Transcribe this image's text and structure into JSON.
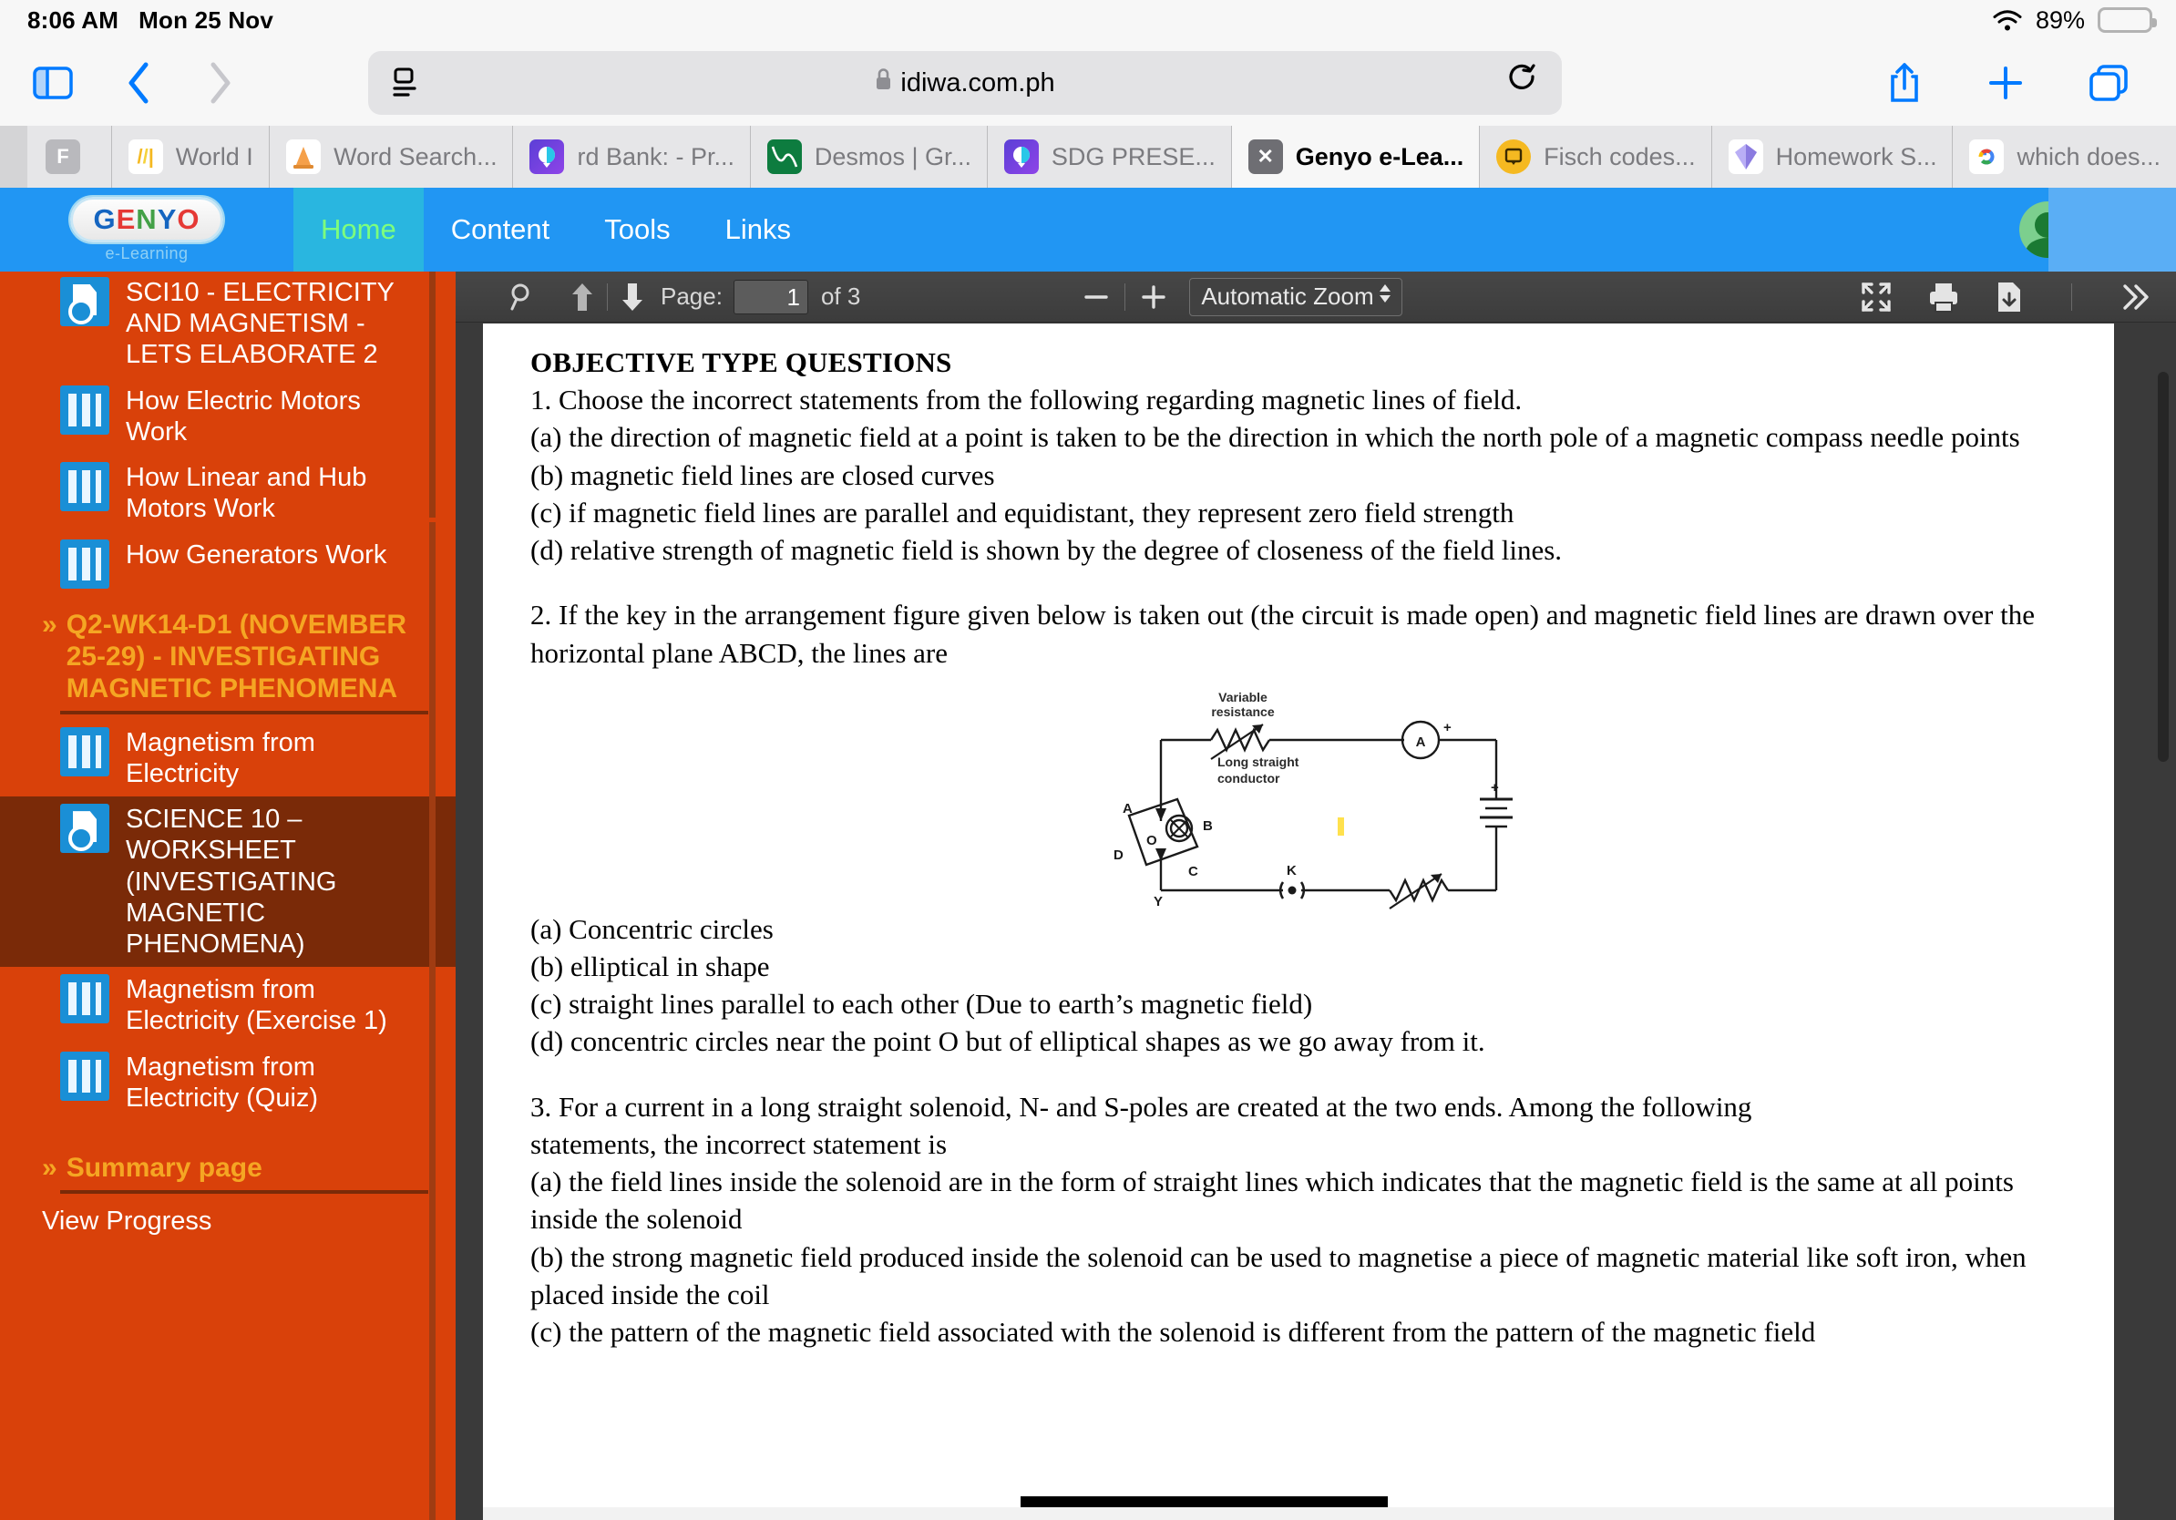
{
  "status_bar": {
    "time": "8:06 AM",
    "date": "Mon 25 Nov",
    "battery_percent": "89%",
    "wifi_icon": "wifi-icon",
    "battery_icon": "battery-icon",
    "battery_color": "#ffcc00"
  },
  "browser": {
    "sidebar_toggle_icon": "sidebar-toggle-icon",
    "back_icon": "chevron-left-icon",
    "forward_icon": "chevron-right-icon",
    "reader_icon": "reader-view-icon",
    "lock_icon": "lock-icon",
    "url": "idiwa.com.ph",
    "reload_icon": "reload-icon",
    "share_icon": "share-icon",
    "new_tab_icon": "plus-icon",
    "tabs_overview_icon": "tabs-overview-icon"
  },
  "tabs": [
    {
      "label": "",
      "favicon": "F",
      "favicon_color": "#b9b9bd",
      "active": false,
      "pinned": true
    },
    {
      "label": "World I",
      "favicon": "//|",
      "favicon_color": "#ffffff",
      "active": false,
      "pinned": false
    },
    {
      "label": "Word Search...",
      "favicon": "traffic-cone-icon",
      "favicon_color": "#ffffff",
      "active": false,
      "pinned": false
    },
    {
      "label": "rd Bank: - Pr...",
      "favicon": "quizizz-icon",
      "favicon_color": "#8854d0",
      "active": false,
      "pinned": false
    },
    {
      "label": "Desmos | Gr...",
      "favicon": "desmos-icon",
      "favicon_color": "#0d7c3f",
      "active": false,
      "pinned": false
    },
    {
      "label": "SDG PRESE...",
      "favicon": "quizizz-icon",
      "favicon_color": "#8854d0",
      "active": false,
      "pinned": false
    },
    {
      "label": "Genyo e-Lea...",
      "favicon": "x-icon",
      "favicon_color": "#6e6e73",
      "active": true,
      "pinned": false
    },
    {
      "label": "Fisch codes...",
      "favicon": "figma-jam-icon",
      "favicon_color": "#f5b921",
      "active": false,
      "pinned": false
    },
    {
      "label": "Homework S...",
      "favicon": "gem-icon",
      "favicon_color": "#ffffff",
      "active": false,
      "pinned": false
    },
    {
      "label": "which does...",
      "favicon": "google-icon",
      "favicon_color": "#ffffff",
      "active": false,
      "pinned": false
    }
  ],
  "genyo_nav": {
    "logo_text": "GENYO",
    "logo_sub": "e-Learning",
    "items": [
      {
        "label": "Home",
        "active": true
      },
      {
        "label": "Content",
        "active": false
      },
      {
        "label": "Tools",
        "active": false
      },
      {
        "label": "Links",
        "active": false
      }
    ],
    "avatar": "user-avatar",
    "chevron": "chevron-down-icon"
  },
  "sidebar": {
    "background": "#d9410a",
    "items": [
      {
        "type": "item",
        "icon": "doc",
        "label": "SCI10 - ELECTRICITY AND MAGNETISM - LETS ELABORATE 2",
        "selected": false
      },
      {
        "type": "item",
        "icon": "bars",
        "label": "How Electric Motors Work",
        "selected": false
      },
      {
        "type": "item",
        "icon": "bars",
        "label": "How Linear and Hub Motors Work",
        "selected": false
      },
      {
        "type": "item",
        "icon": "bars",
        "label": "How Generators Work",
        "selected": false
      },
      {
        "type": "section",
        "label": "Q2-WK14-D1 (NOVEMBER 25-29) - INVESTIGATING MAGNETIC PHENOMENA",
        "chevron": "»"
      },
      {
        "type": "item",
        "icon": "bars",
        "label": "Magnetism from Electricity",
        "selected": false
      },
      {
        "type": "item",
        "icon": "doc",
        "label": "SCIENCE 10 – WORKSHEET (INVESTIGATING MAGNETIC PHENOMENA)",
        "selected": true
      },
      {
        "type": "item",
        "icon": "bars",
        "label": "Magnetism from Electricity (Exercise 1)",
        "selected": false
      },
      {
        "type": "item",
        "icon": "bars",
        "label": "Magnetism from Electricity (Quiz)",
        "selected": false
      },
      {
        "type": "section",
        "label": "Summary page",
        "chevron": "»"
      },
      {
        "type": "plain",
        "label": "View Progress"
      }
    ]
  },
  "pdf_toolbar": {
    "search_icon": "search-icon",
    "prev_page_icon": "arrow-up-icon",
    "next_page_icon": "arrow-down-icon",
    "page_label": "Page:",
    "page_value": "1",
    "page_total": "of 3",
    "zoom_out_icon": "minus-icon",
    "zoom_in_icon": "plus-icon",
    "zoom_value": "Automatic Zoom",
    "presentation_icon": "fullscreen-icon",
    "print_icon": "print-icon",
    "download_icon": "download-icon",
    "more_icon": "double-chevron-right-icon"
  },
  "document": {
    "heading": "OBJECTIVE TYPE QUESTIONS",
    "q1": {
      "stem": "1. Choose the incorrect statements from the following regarding magnetic lines of field.",
      "options": [
        "(a) the direction of magnetic field at a point is taken to be the direction in which the north pole of a magnetic compass needle points",
        "(b) magnetic field lines are closed curves",
        "(c) if magnetic field lines are parallel and equidistant, they represent zero field strength",
        "(d) relative strength of magnetic field is shown by the degree of closeness of the field lines."
      ]
    },
    "q2": {
      "stem": "2. If the key in the arrangement figure given below is taken out (the circuit is made open) and magnetic field lines are drawn over the horizontal plane ABCD, the lines are",
      "figure": {
        "labels": [
          "Variable resistance",
          "Long straight conductor",
          "A",
          "B",
          "C",
          "D",
          "O",
          "K",
          "Y",
          "A",
          "+",
          "+"
        ],
        "variable_resistance": "Variable\nresistance",
        "conductor": "Long straight\nconductor",
        "ammeter": "A",
        "plane_points": [
          "A",
          "B",
          "C",
          "D"
        ],
        "center": "O",
        "key": "K",
        "terminal": "Y"
      },
      "options": [
        "(a) Concentric circles",
        "(b) elliptical in shape",
        "(c) straight lines parallel to each other (Due to earth’s magnetic field)",
        "(d) concentric circles near the point O but of elliptical shapes as we go away from it."
      ]
    },
    "q3": {
      "stem": "3. For a current in a long straight solenoid, N- and S-poles are created at the two ends. Among the following statements, the incorrect statement is",
      "options": [
        "(a) the field lines inside the solenoid are in the form of straight lines which indicates that the magnetic field is the same at all points inside the solenoid",
        "(b) the strong magnetic field produced inside the solenoid can be used to magnetise a piece of magnetic material like soft iron, when placed inside the coil",
        "(c) the pattern of the magnetic field associated with the solenoid is different from the pattern of the magnetic field"
      ]
    }
  }
}
